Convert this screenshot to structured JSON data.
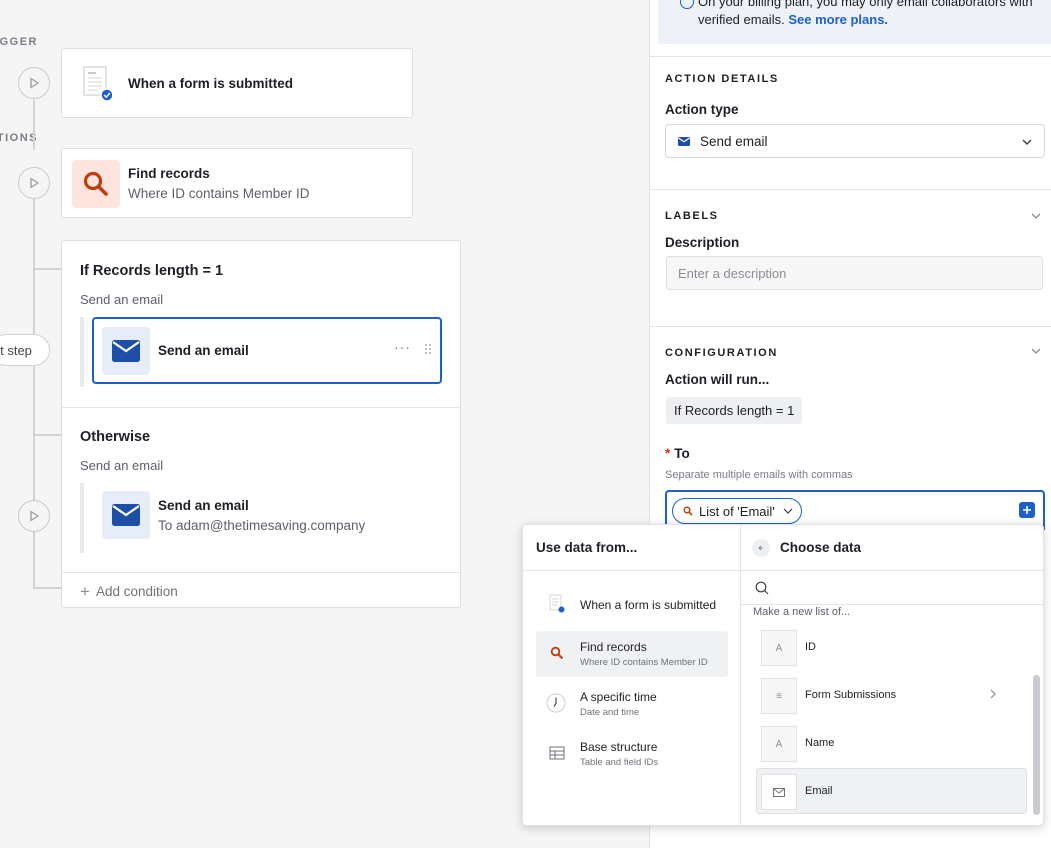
{
  "canvas": {
    "trigger_label": "TRIGGER",
    "actions_label": "ACTIONS",
    "trigger_card": {
      "title": "When a form is submitted"
    },
    "find_card": {
      "title": "Find records",
      "subtitle": "Where ID contains Member ID"
    },
    "condition_group": {
      "if_title": "If Records length = 1",
      "if_sub": "Send an email",
      "if_step": {
        "title": "Send an email"
      },
      "otherwise_title": "Otherwise",
      "otherwise_sub": "Send an email",
      "otherwise_step": {
        "title": "Send an email",
        "subtitle": "To adam@thetimesaving.company"
      },
      "add_condition": "Add condition"
    },
    "next_step_label": "Next step"
  },
  "panel": {
    "banner_text": "On your billing plan, you may only email collaborators with verified emails.",
    "banner_link": "See more plans.",
    "action_details": {
      "heading": "ACTION DETAILS",
      "action_type_label": "Action type",
      "action_type_value": "Send email"
    },
    "labels": {
      "heading": "LABELS",
      "description_label": "Description",
      "description_placeholder": "Enter a description"
    },
    "configuration": {
      "heading": "CONFIGURATION",
      "will_run_label": "Action will run...",
      "will_run_chip": "If Records length = 1",
      "to_required": "*",
      "to_label": "To",
      "to_hint": "Separate multiple emails with commas",
      "to_token": "List of 'Email'"
    }
  },
  "popover": {
    "left_heading": "Use data from...",
    "sources": [
      {
        "title": "When a form is submitted",
        "subtitle": ""
      },
      {
        "title": "Find records",
        "subtitle": "Where ID contains Member ID"
      },
      {
        "title": "A specific time",
        "subtitle": "Date and time"
      },
      {
        "title": "Base structure",
        "subtitle": "Table and field IDs"
      }
    ],
    "right_heading": "Choose data",
    "list_caption": "Make a new list of...",
    "fields": [
      {
        "label": "ID",
        "icon": "text-field-icon"
      },
      {
        "label": "Form Submissions",
        "icon": "linked-record-icon"
      },
      {
        "label": "Name",
        "icon": "text-field-icon"
      },
      {
        "label": "Email",
        "icon": "mail-icon"
      }
    ]
  },
  "colors": {
    "accent": "#1b61c9",
    "find_icon": "#c23b0c",
    "selected_bg": "#f0f1f3"
  }
}
